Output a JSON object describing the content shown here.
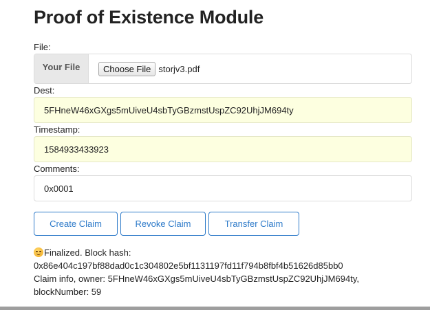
{
  "title": "Proof of Existence Module",
  "file": {
    "label": "File:",
    "addon": "Your File",
    "button_label": "Choose File",
    "file_name": "storjv3.pdf"
  },
  "dest": {
    "label": "Dest:",
    "value": "5FHneW46xGXgs5mUiveU4sbTyGBzmstUspZC92UhjJM694ty"
  },
  "timestamp": {
    "label": "Timestamp:",
    "value": "1584933433923"
  },
  "comments": {
    "label": "Comments:",
    "value": "0x0001"
  },
  "buttons": {
    "create": "Create Claim",
    "revoke": "Revoke Claim",
    "transfer": "Transfer Claim"
  },
  "status": {
    "emoji_icon": "smirking-face-icon",
    "finalized": "Finalized. Block hash:",
    "block_hash": "0x86e404c197bf88dad0c1c304802e5bf1131197fd11f794b8fbf4b51626d85bb0",
    "claim_info": "Claim info, owner: 5FHneW46xGXgs5mUiveU4sbTyGBzmstUspZC92UhjJM694ty,",
    "block_number": "blockNumber: 59"
  },
  "colors": {
    "accent": "#2d7ac9",
    "autofill_bg": "#fdffe0",
    "addon_bg": "#e8e8e8"
  }
}
